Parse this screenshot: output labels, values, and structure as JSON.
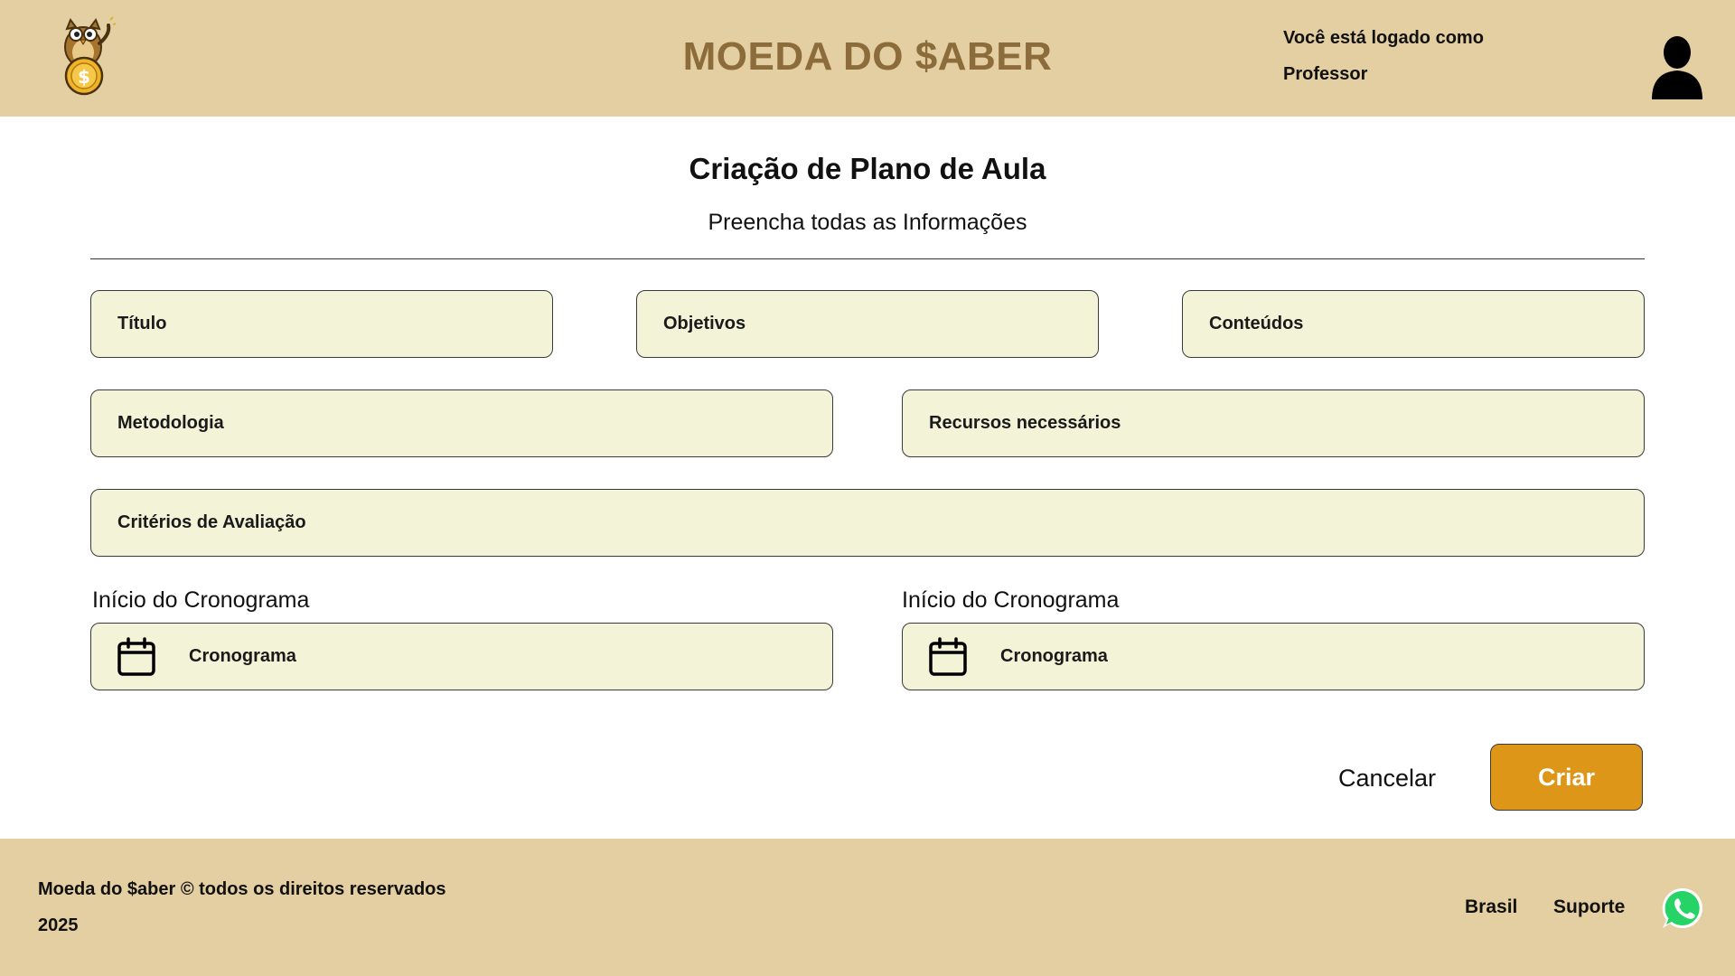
{
  "header": {
    "brand": "MOEDA DO $ABER",
    "login_line1": "Você está logado como",
    "login_line2": "Professor"
  },
  "main": {
    "title": "Criação de Plano de Aula",
    "subtitle": "Preencha todas as Informações",
    "fields": {
      "titulo": "Título",
      "objetivos": "Objetivos",
      "conteudos": "Conteúdos",
      "metodologia": "Metodologia",
      "recursos": "Recursos necessários",
      "criterios": "Critérios de Avaliação"
    },
    "schedule": [
      {
        "label": "Início do Cronograma",
        "placeholder": "Cronograma"
      },
      {
        "label": "Início do Cronograma",
        "placeholder": "Cronograma"
      }
    ],
    "actions": {
      "cancel": "Cancelar",
      "create": "Criar"
    }
  },
  "footer": {
    "copyright_line1": "Moeda do $aber © todos os direitos reservados",
    "copyright_line2": "2025",
    "links": [
      "Brasil",
      "Suporte"
    ]
  },
  "icons": {
    "logo": "owl-coin-logo-icon",
    "avatar": "user-avatar-icon",
    "calendar": "calendar-icon",
    "whatsapp": "whatsapp-icon"
  },
  "colors": {
    "header_bg": "#e4cfa2",
    "brand_text": "#8b6c3a",
    "field_bg": "#f3f3d8",
    "primary_button": "#dd9618"
  }
}
